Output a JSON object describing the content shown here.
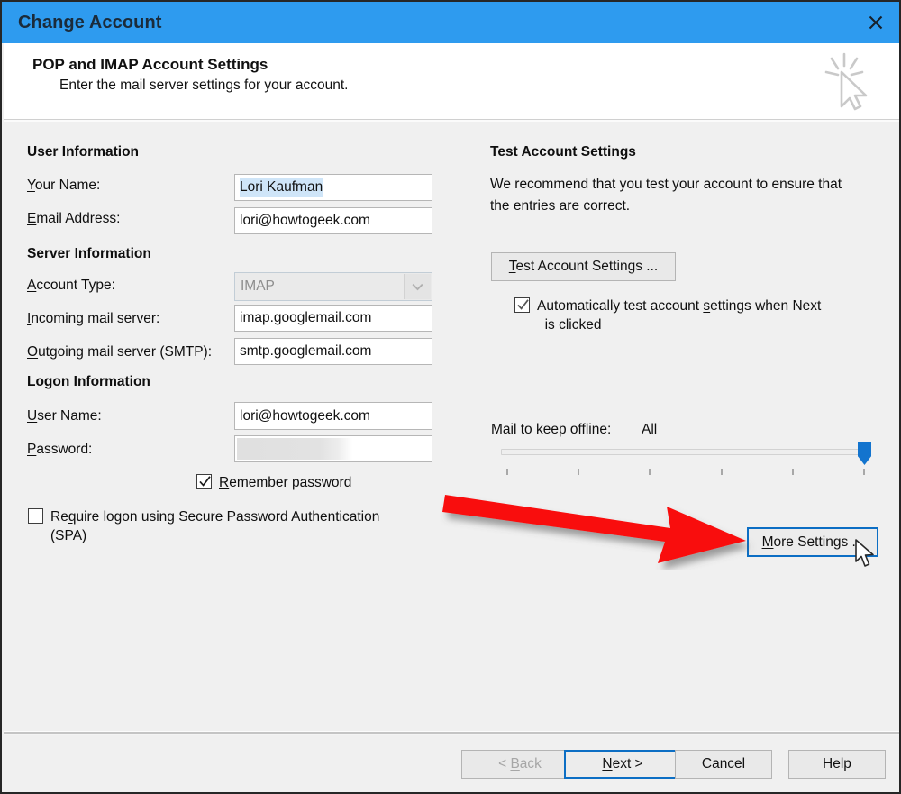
{
  "window": {
    "title": "Change Account",
    "close_icon": "close-icon"
  },
  "header": {
    "title": "POP and IMAP Account Settings",
    "subtitle": "Enter the mail server settings for your account.",
    "icon": "cursor-click-icon"
  },
  "left_panel": {
    "user_information": {
      "heading": "User Information",
      "fields": [
        {
          "label": "Your Name:",
          "accel": "Y",
          "value": "Lori Kaufman",
          "selected": true
        },
        {
          "label": "Email Address:",
          "accel": "E",
          "value": "lori@howtogeek.com",
          "selected": false
        }
      ]
    },
    "server_information": {
      "heading": "Server Information",
      "account_type": {
        "label": "Account Type:",
        "accel": "A",
        "value": "IMAP",
        "disabled": true,
        "icon": "chevron-down-icon"
      },
      "fields": [
        {
          "label": "Incoming mail server:",
          "accel": "I",
          "value": "imap.googlemail.com"
        },
        {
          "label": "Outgoing mail server (SMTP):",
          "accel": "O",
          "value": "smtp.googlemail.com"
        }
      ]
    },
    "logon_information": {
      "heading": "Logon Information",
      "fields": [
        {
          "label": "User Name:",
          "accel": "U",
          "value": "lori@howtogeek.com"
        },
        {
          "label": "Password:",
          "accel": "P",
          "value": "",
          "masked": true
        }
      ],
      "remember_password": {
        "label": "Remember password",
        "accel": "R",
        "checked": true
      },
      "require_spa": {
        "label": "Require logon using Secure Password Authentication (SPA)",
        "line1": "Require logon using Secure Password Authentication",
        "line2": "(SPA)",
        "accel": "q",
        "checked": false
      }
    }
  },
  "right_panel": {
    "heading": "Test Account Settings",
    "description": "We recommend that you test your account to ensure that the entries are correct.",
    "description_line1": "We recommend that you test your account to ensure that",
    "description_line2": "the entries are correct.",
    "test_button": {
      "label": "Test Account Settings ...",
      "accel": "T"
    },
    "auto_test": {
      "line1": "Automatically test account settings when Next",
      "line2": "is clicked",
      "checked": true
    },
    "mail_offline": {
      "label": "Mail to keep offline:",
      "value": "All",
      "slider_position_percent": 100,
      "tick_count": 6
    },
    "more_settings_button": {
      "label": "More Settings ...",
      "accel": "M",
      "focused": true
    }
  },
  "footer": {
    "buttons": [
      {
        "label": "< Back",
        "accel": "B",
        "disabled": true,
        "focused": false
      },
      {
        "label": "Next >",
        "accel": "N",
        "disabled": false,
        "focused": true
      },
      {
        "label": "Cancel",
        "accel": "",
        "disabled": false,
        "focused": false
      },
      {
        "label": "Help",
        "accel": "",
        "disabled": false,
        "focused": false
      }
    ]
  },
  "annotation": {
    "arrow_color": "#f91010",
    "arrow_name": "red-pointer-arrow"
  },
  "colors": {
    "titlebar": "#2e9bef",
    "body": "#f0f0f0",
    "accent_focus": "#0c6ec4",
    "selection": "#cfe5f8",
    "slider_thumb": "#1374ce"
  }
}
